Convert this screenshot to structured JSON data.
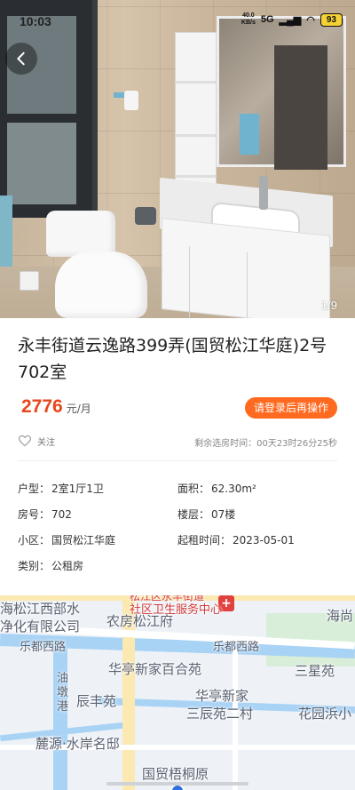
{
  "status_bar": {
    "time": "10:03",
    "speed_value": "40.0",
    "speed_unit": "KB/s",
    "network": "5G",
    "battery": "93"
  },
  "photo": {
    "counter": "1/9",
    "back_icon": "chevron-left-icon"
  },
  "listing": {
    "title": "永丰街道云逸路399弄(国贸松江华庭)2号702室",
    "price": "2776",
    "price_unit": "元/月",
    "login_button": "请登录后再操作",
    "follow_label": "关注",
    "countdown": "剩余选房时间：00天23时26分25秒"
  },
  "attributes": [
    {
      "key": "户型：",
      "value": "2室1厅1卫"
    },
    {
      "key": "面积：",
      "value": "62.30m²"
    },
    {
      "key": "房号：",
      "value": "702"
    },
    {
      "key": "楼层：",
      "value": "07楼"
    },
    {
      "key": "小区：",
      "value": "国贸松江华庭"
    },
    {
      "key": "起租时间：",
      "value": "2023-05-01"
    },
    {
      "key": "类别：",
      "value": "公租房"
    }
  ],
  "map": {
    "labels": {
      "top_banner": "社区卫生服务中心",
      "top_partial": "松江区永丰街道",
      "l1": "海松江西部水",
      "l2": "净化有限公司",
      "l3": "农房松江府",
      "l4": "海尚",
      "l5": "乐都西路",
      "l6": "乐都西路",
      "l7": "华亭新家百合苑",
      "l8": "三星苑",
      "l9": "油墩港",
      "l10": "辰丰苑",
      "l11": "华亭新家",
      "l12": "三辰苑二村",
      "l13": "花园浜小",
      "l14": "麓源·水岸名邸",
      "l15": "国贸梧桐原"
    }
  }
}
